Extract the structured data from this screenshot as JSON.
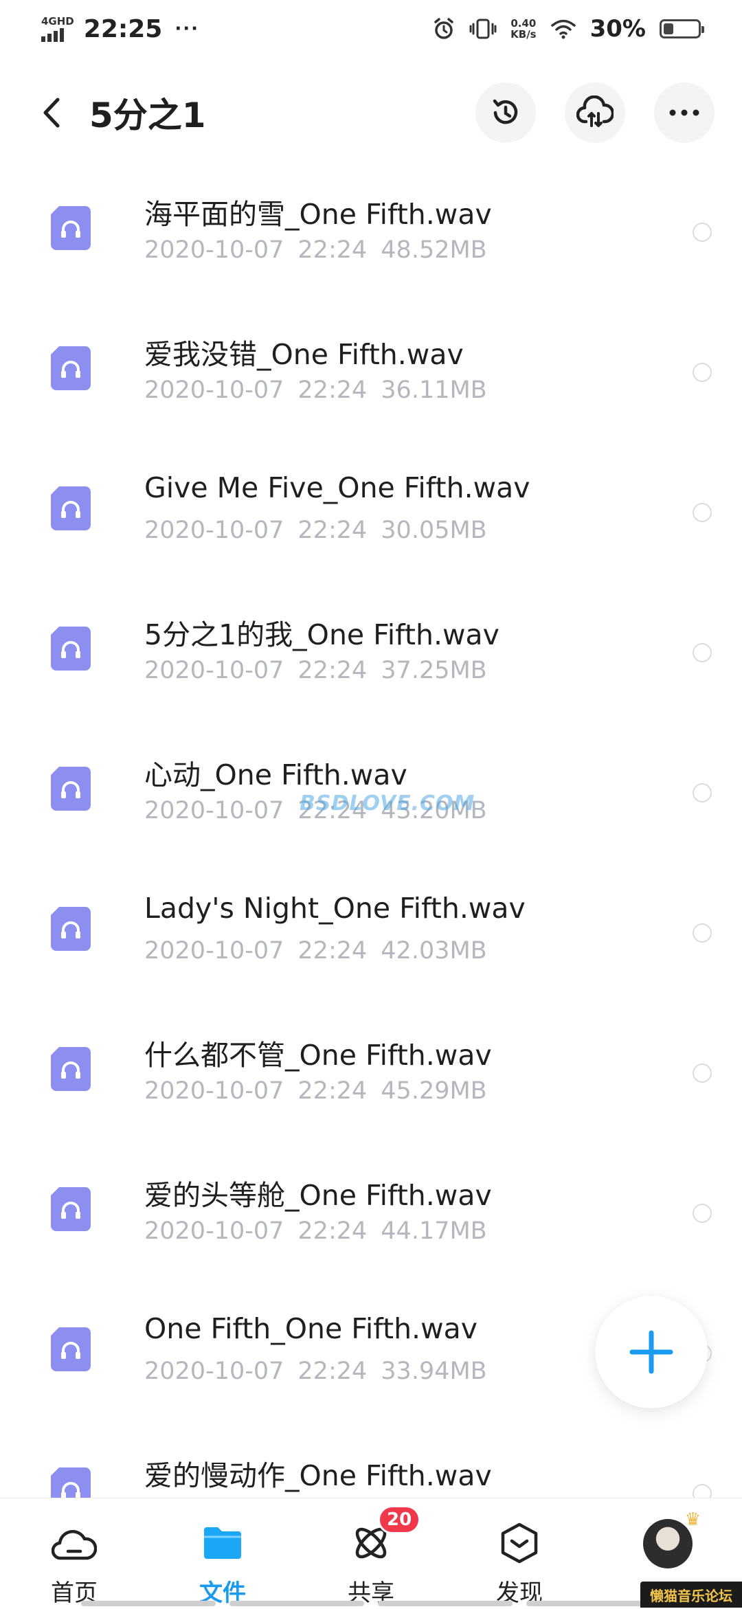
{
  "status_bar": {
    "network": "4GHD",
    "time": "22:25",
    "more": "···",
    "speed_value": "0.40",
    "speed_unit": "KB/s",
    "battery_percent": "30%"
  },
  "header": {
    "title": "5分之1"
  },
  "files": [
    {
      "name": "海平面的雪_One Fifth.wav",
      "date": "2020-10-07",
      "time": "22:24",
      "size": "48.52MB"
    },
    {
      "name": "爱我没错_One Fifth.wav",
      "date": "2020-10-07",
      "time": "22:24",
      "size": "36.11MB"
    },
    {
      "name": "Give Me Five_One Fifth.wav",
      "date": "2020-10-07",
      "time": "22:24",
      "size": "30.05MB"
    },
    {
      "name": "5分之1的我_One Fifth.wav",
      "date": "2020-10-07",
      "time": "22:24",
      "size": "37.25MB"
    },
    {
      "name": "心动_One Fifth.wav",
      "date": "2020-10-07",
      "time": "22:24",
      "size": "43.20MB"
    },
    {
      "name": "Lady's Night_One Fifth.wav",
      "date": "2020-10-07",
      "time": "22:24",
      "size": "42.03MB"
    },
    {
      "name": "什么都不管_One Fifth.wav",
      "date": "2020-10-07",
      "time": "22:24",
      "size": "45.29MB"
    },
    {
      "name": "爱的头等舱_One Fifth.wav",
      "date": "2020-10-07",
      "time": "22:24",
      "size": "44.17MB"
    },
    {
      "name": "One Fifth_One Fifth.wav",
      "date": "2020-10-07",
      "time": "22:24",
      "size": "33.94MB"
    },
    {
      "name": "爱的慢动作_One Fifth.wav",
      "date": "",
      "time": "",
      "size": ""
    }
  ],
  "watermark": "BSDLOVE.COM",
  "nav": {
    "home": "首页",
    "files": "文件",
    "share": "共享",
    "share_badge": "20",
    "discover": "发现",
    "mine": "我的"
  },
  "forum_tag": "懒猫音乐论坛",
  "colors": {
    "accent": "#1a9bf0",
    "file_icon": "#8c8ef0",
    "badge": "#f0384a",
    "meta_text": "#b4b7bd"
  }
}
